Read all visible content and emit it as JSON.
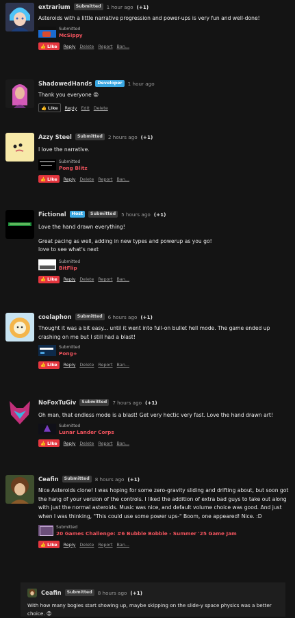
{
  "comments": [
    {
      "user": "extrarium",
      "badges": [
        "Submitted"
      ],
      "time": "1 hour ago",
      "votes": "(+1)",
      "text": [
        "Asteroids with a little narrative progression and power-ups is very fun and well-done!"
      ],
      "game": {
        "submitted": "Submitted",
        "name": "McSippy"
      },
      "like": "Like",
      "actions": [
        "Reply",
        "Delete",
        "Report",
        "Ban..."
      ]
    },
    {
      "user": "ShadowedHands",
      "badges": [
        "Developer"
      ],
      "time": "1 hour ago",
      "votes": "",
      "text": [
        "Thank you everyone 😡"
      ],
      "like": "Like",
      "actions": [
        "Reply",
        "Edit",
        "Delete"
      ]
    },
    {
      "user": "Azzy Steel",
      "badges": [
        "Submitted"
      ],
      "time": "2 hours ago",
      "votes": "(+1)",
      "text": [
        "I love the narrative."
      ],
      "game": {
        "submitted": "Submitted",
        "name": "Pong Blitz"
      },
      "like": "Like",
      "actions": [
        "Reply",
        "Delete",
        "Report",
        "Ban..."
      ]
    },
    {
      "user": "Fictional",
      "badges": [
        "Host",
        "Submitted"
      ],
      "time": "5 hours ago",
      "votes": "(+1)",
      "text": [
        "Love the hand drawn everything!",
        "Great pacing as well, adding in new types and powerup as you go!\nlove to see what's next"
      ],
      "game": {
        "submitted": "Submitted",
        "name": "BitFlip"
      },
      "like": "Like",
      "actions": [
        "Reply",
        "Delete",
        "Report",
        "Ban..."
      ]
    },
    {
      "user": "coelaphon",
      "badges": [
        "Submitted"
      ],
      "time": "6 hours ago",
      "votes": "(+1)",
      "text": [
        "Thought it was a bit easy... until it went into full-on bullet hell mode. The game ended up crashing on me but I still had a blast!"
      ],
      "game": {
        "submitted": "Submitted",
        "name": "Pong+"
      },
      "like": "Like",
      "actions": [
        "Reply",
        "Delete",
        "Report",
        "Ban..."
      ]
    },
    {
      "user": "NoFoxTuGiv",
      "badges": [
        "Submitted"
      ],
      "time": "7 hours ago",
      "votes": "(+1)",
      "text": [
        "Oh man, that endless mode is a blast! Get very hectic very fast. Love the hand drawn art!"
      ],
      "game": {
        "submitted": "Submitted",
        "name": "Lunar Lander Corps"
      },
      "like": "Like",
      "actions": [
        "Reply",
        "Delete",
        "Report",
        "Ban..."
      ]
    },
    {
      "user": "Ceafin",
      "badges": [
        "Submitted"
      ],
      "time": "8 hours ago",
      "votes": "(+1)",
      "text": [
        "Nice Asteroids clone! I was hoping for some zero-gravity sliding and drifting about, but soon got the hang of your version of the controls. I liked the addition of extra bad guys to take out along with just the normal asteroids. Music was nice, and default volume choice was good. And just when I was thinking, \"This could use some power ups-\" Boom, one appeared! Nice. :D"
      ],
      "game": {
        "submitted": "Submitted",
        "name": "20 Games Challenge: #6 Bubble Bobble - Summer '25 Game Jam"
      },
      "like": "Like",
      "actions": [
        "Reply",
        "Delete",
        "Report",
        "Ban..."
      ]
    }
  ],
  "reply": {
    "user": "Ceafin",
    "badges": [
      "Submitted"
    ],
    "time": "8 hours ago",
    "votes": "(+1)",
    "text": "With how many bogies start showing up, maybe skipping on the slide-y space physics was a better choice. 😡"
  }
}
